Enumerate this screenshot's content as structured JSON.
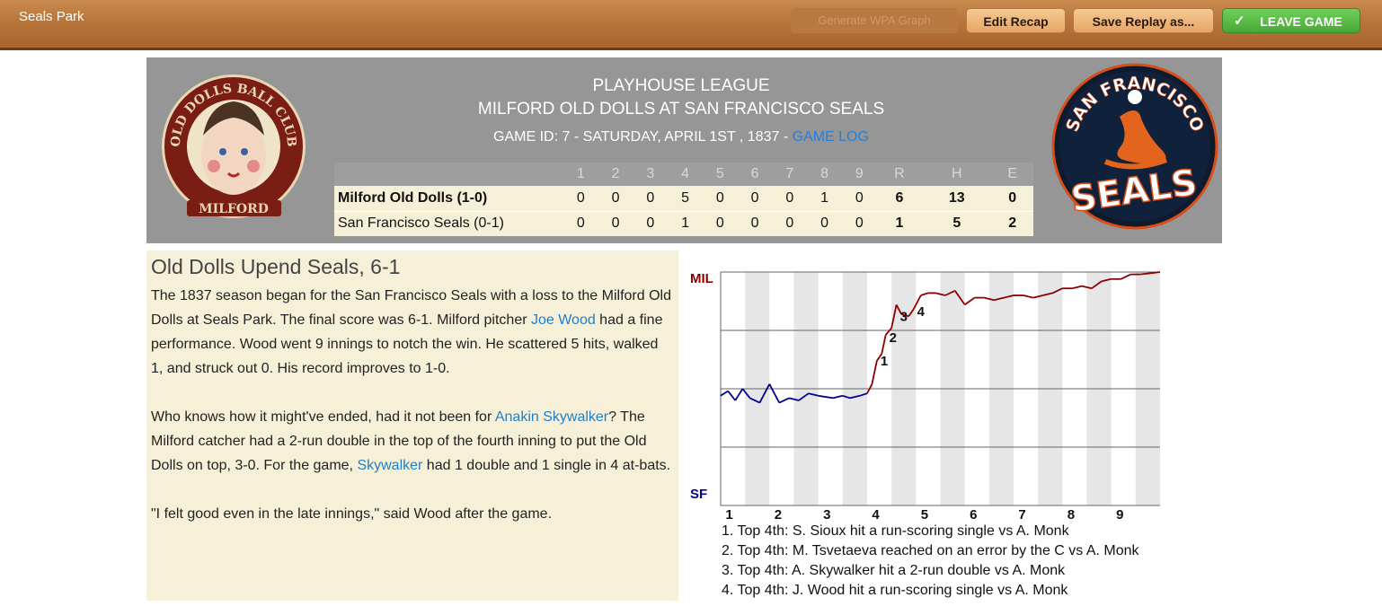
{
  "topbar": {
    "park_name": "Seals Park",
    "wpa_button": "Generate WPA Graph",
    "edit_button": "Edit Recap",
    "save_button": "Save Replay as...",
    "leave_button": "LEAVE GAME"
  },
  "header": {
    "league": "PLAYHOUSE LEAGUE",
    "matchup": "MILFORD OLD DOLLS AT SAN FRANCISCO SEALS",
    "game_id_text": "GAME ID: 7 - SATURDAY, APRIL 1ST , 1837 - ",
    "game_log_link": "GAME LOG",
    "left_logo": {
      "top_text": "OLD DOLLS BALL CLUB",
      "bottom_text": "MILFORD"
    },
    "right_logo": {
      "top_text": "SAN FRANCISCO",
      "bottom_text": "SEALS"
    }
  },
  "linescore": {
    "columns": [
      "1",
      "2",
      "3",
      "4",
      "5",
      "6",
      "7",
      "8",
      "9",
      "R",
      "H",
      "E"
    ],
    "rows": [
      {
        "team": "Milford Old Dolls (1-0)",
        "cells": [
          "0",
          "0",
          "0",
          "5",
          "0",
          "0",
          "0",
          "1",
          "0",
          "6",
          "13",
          "0"
        ]
      },
      {
        "team": "San Francisco Seals (0-1)",
        "cells": [
          "0",
          "0",
          "0",
          "1",
          "0",
          "0",
          "0",
          "0",
          "0",
          "1",
          "5",
          "2"
        ]
      }
    ]
  },
  "recap": {
    "headline": "Old Dolls Upend Seals, 6-1",
    "p1_a": "The 1837 season began for the San Francisco Seals with a loss to the Milford Old Dolls at Seals Park. The final score was 6-1. Milford pitcher ",
    "p1_link": "Joe Wood",
    "p1_b": " had a fine performance. Wood went 9 innings to notch the win. He scattered 5 hits, walked 1, and struck out 0. His record improves to 1-0.",
    "p2_a": "Who knows how it might've ended, had it not been for ",
    "p2_link1": "Anakin Skywalker",
    "p2_b": "? The Milford catcher had a 2-run double in the top of the fourth inning to put the Old Dolls on top, 3-0. For the game, ",
    "p2_link2": "Skywalker",
    "p2_c": " had 1 double and 1 single in 4 at-bats.",
    "p3": "\"I felt good even in the late innings,\" said Wood after the game."
  },
  "wpa": {
    "top_team": "MIL",
    "bottom_team": "SF",
    "colors": {
      "mil": "#8b0000",
      "sf": "#00008b"
    },
    "inning_labels": [
      "1",
      "2",
      "3",
      "4",
      "5",
      "6",
      "7",
      "8",
      "9"
    ],
    "event_labels": [
      "1",
      "2",
      "3",
      "4"
    ],
    "notes": [
      "1. Top 4th: S. Sioux hit a run-scoring single vs A. Monk",
      "2. Top 4th: M. Tsvetaeva reached on an error by the C vs A. Monk",
      "3. Top 4th: A. Skywalker hit a 2-run double vs A. Monk",
      "4. Top 4th: J. Wood hit a run-scoring single vs A. Monk"
    ],
    "series": [
      {
        "x": 0,
        "y": 0.47
      },
      {
        "x": 0.15,
        "y": 0.49
      },
      {
        "x": 0.3,
        "y": 0.45
      },
      {
        "x": 0.45,
        "y": 0.5
      },
      {
        "x": 0.6,
        "y": 0.46
      },
      {
        "x": 0.8,
        "y": 0.44
      },
      {
        "x": 1.0,
        "y": 0.52
      },
      {
        "x": 1.2,
        "y": 0.44
      },
      {
        "x": 1.4,
        "y": 0.46
      },
      {
        "x": 1.6,
        "y": 0.45
      },
      {
        "x": 1.8,
        "y": 0.48
      },
      {
        "x": 2.0,
        "y": 0.47
      },
      {
        "x": 2.3,
        "y": 0.46
      },
      {
        "x": 2.5,
        "y": 0.47
      },
      {
        "x": 2.65,
        "y": 0.46
      },
      {
        "x": 2.85,
        "y": 0.47
      },
      {
        "x": 3.0,
        "y": 0.48
      },
      {
        "x": 3.1,
        "y": 0.52
      },
      {
        "x": 3.2,
        "y": 0.62
      },
      {
        "x": 3.3,
        "y": 0.65
      },
      {
        "x": 3.38,
        "y": 0.73
      },
      {
        "x": 3.5,
        "y": 0.76
      },
      {
        "x": 3.6,
        "y": 0.86
      },
      {
        "x": 3.7,
        "y": 0.82
      },
      {
        "x": 3.85,
        "y": 0.81
      },
      {
        "x": 3.95,
        "y": 0.84
      },
      {
        "x": 4.1,
        "y": 0.9
      },
      {
        "x": 4.25,
        "y": 0.91
      },
      {
        "x": 4.4,
        "y": 0.91
      },
      {
        "x": 4.6,
        "y": 0.9
      },
      {
        "x": 4.8,
        "y": 0.92
      },
      {
        "x": 5.0,
        "y": 0.86
      },
      {
        "x": 5.2,
        "y": 0.89
      },
      {
        "x": 5.4,
        "y": 0.89
      },
      {
        "x": 5.6,
        "y": 0.88
      },
      {
        "x": 5.8,
        "y": 0.89
      },
      {
        "x": 6.0,
        "y": 0.9
      },
      {
        "x": 6.2,
        "y": 0.9
      },
      {
        "x": 6.4,
        "y": 0.89
      },
      {
        "x": 6.6,
        "y": 0.9
      },
      {
        "x": 6.8,
        "y": 0.91
      },
      {
        "x": 7.0,
        "y": 0.93
      },
      {
        "x": 7.2,
        "y": 0.93
      },
      {
        "x": 7.4,
        "y": 0.94
      },
      {
        "x": 7.6,
        "y": 0.93
      },
      {
        "x": 7.8,
        "y": 0.96
      },
      {
        "x": 8.0,
        "y": 0.97
      },
      {
        "x": 8.2,
        "y": 0.97
      },
      {
        "x": 8.4,
        "y": 0.99
      },
      {
        "x": 8.6,
        "y": 0.99
      },
      {
        "x": 8.8,
        "y": 0.995
      },
      {
        "x": 9.0,
        "y": 1.0
      }
    ],
    "event_points": [
      {
        "x": 3.2,
        "y": 0.62
      },
      {
        "x": 3.38,
        "y": 0.72
      },
      {
        "x": 3.6,
        "y": 0.81
      },
      {
        "x": 3.95,
        "y": 0.83
      }
    ]
  }
}
